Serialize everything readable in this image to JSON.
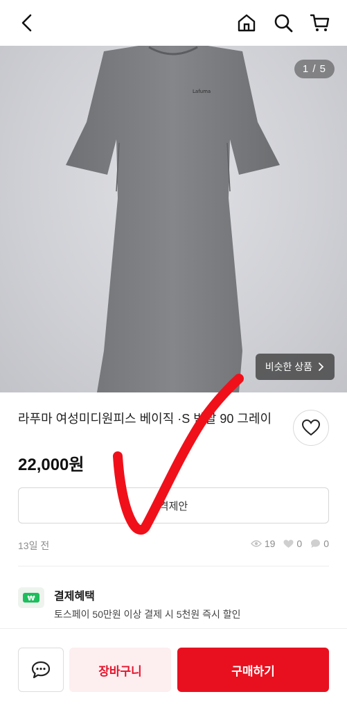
{
  "header": {
    "back_icon": "chevron-left-icon",
    "home_icon": "home-icon",
    "search_icon": "search-icon",
    "cart_icon": "cart-icon"
  },
  "gallery": {
    "counter": "1 / 5",
    "current_image": 1,
    "total_images": 5,
    "similar_label": "비슷한 상품",
    "brand_print": "Lafuma"
  },
  "product": {
    "title": "라푸마 여성미디원피스 베이직 ·S 반팔 90 그레이",
    "price": "22,000원"
  },
  "offer": {
    "label": "격제안"
  },
  "meta": {
    "time_ago": "13일 전",
    "views": "19",
    "likes": "0",
    "chats": "0"
  },
  "benefit": {
    "title": "결제혜택",
    "description": "토스페이 50만원 이상 결제 시 5천원 즉시 할인",
    "icon_symbol": "₩"
  },
  "actions": {
    "cart_label": "장바구니",
    "buy_label": "구매하기"
  },
  "colors": {
    "accent": "#e8101f",
    "accent_light": "#fdeef0",
    "overlay_mark": "#f0101a"
  }
}
